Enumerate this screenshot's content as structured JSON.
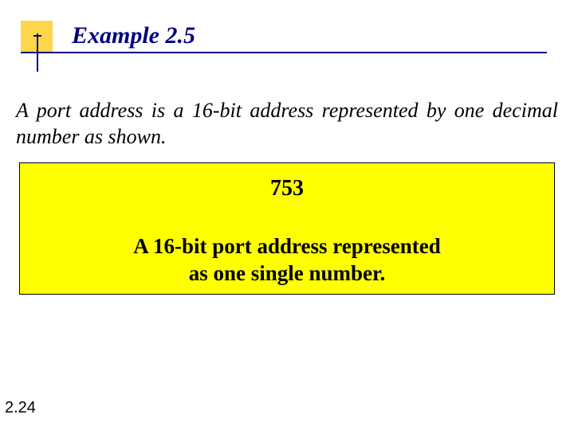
{
  "title": "Example 2.5",
  "body": "A port address is a 16-bit address represented by one decimal number as shown.",
  "box": {
    "value": "753",
    "desc_line1": "A 16-bit port address represented",
    "desc_line2": "as one single number."
  },
  "page_number": "2.24"
}
